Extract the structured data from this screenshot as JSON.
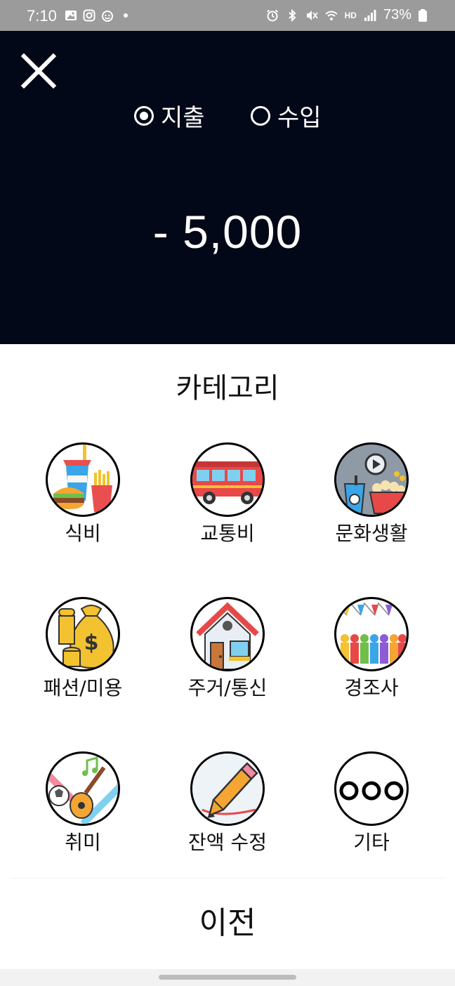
{
  "status_bar": {
    "time": "7:10",
    "battery": "73%",
    "network_label": "HD"
  },
  "header": {
    "type_options": [
      {
        "label": "지출",
        "selected": true
      },
      {
        "label": "수입",
        "selected": false
      }
    ],
    "amount": "- 5,000"
  },
  "category_section": {
    "title": "카테고리",
    "items": [
      {
        "label": "식비",
        "icon": "food-icon"
      },
      {
        "label": "교통비",
        "icon": "bus-icon"
      },
      {
        "label": "문화생활",
        "icon": "cinema-icon"
      },
      {
        "label": "패션/미용",
        "icon": "money-bag-icon"
      },
      {
        "label": "주거/통신",
        "icon": "house-icon"
      },
      {
        "label": "경조사",
        "icon": "celebration-icon"
      },
      {
        "label": "취미",
        "icon": "hobby-icon"
      },
      {
        "label": "잔액 수정",
        "icon": "pencil-icon"
      },
      {
        "label": "기타",
        "icon": "more-icon"
      }
    ]
  },
  "footer": {
    "prev_label": "이전"
  },
  "colors": {
    "header_bg": "#020817",
    "status_bg": "#9b9b9b"
  }
}
